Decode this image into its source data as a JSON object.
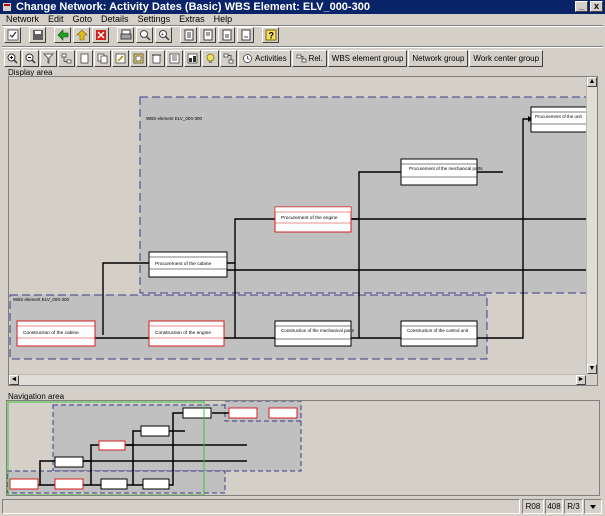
{
  "window": {
    "title": "Change Network:  Activity Dates (Basic) WBS Element: ELV_000-300",
    "minimize": "_",
    "close": "x"
  },
  "menu": {
    "items": [
      "Network",
      "Edit",
      "Goto",
      "Details",
      "Settings",
      "Extras",
      "Help"
    ]
  },
  "toolbar": {
    "text_buttons": {
      "activities": "Activities",
      "rel": "Rel.",
      "wbs_element_group": "WBS element group",
      "network_group": "Network group",
      "work_center_group": "Work center group"
    }
  },
  "areas": {
    "display": "Display area",
    "navigation": "Navigation area"
  },
  "graphic": {
    "wbs_top": "WBS element ELV_000-300",
    "wbs_bottom": "WBS element ELV_000-300",
    "nodes": {
      "procure_engine": "Procurement of the engine",
      "procure_mech": "Procurement of the mechanical parts",
      "procure_cabine": "Procurement of the cabine",
      "construct_cabine": "Construction of the cabine",
      "construct_engine": "Construction of the engine",
      "construct_mech": "Construction of the mechanical parts",
      "construct_control": "Construction of the control unit",
      "top_right": "Procurement of the unit"
    }
  },
  "status": {
    "system": "R08",
    "client": "408",
    "mode": "R/3"
  },
  "colors": {
    "title_bar": "#0a246a",
    "window_face": "#d4d0c8",
    "wbs_box_fill": "#c0c0c0",
    "wbs_border": "#3a3a8a",
    "red_node_border": "#d02020",
    "nav_highlight": "#40c040"
  }
}
